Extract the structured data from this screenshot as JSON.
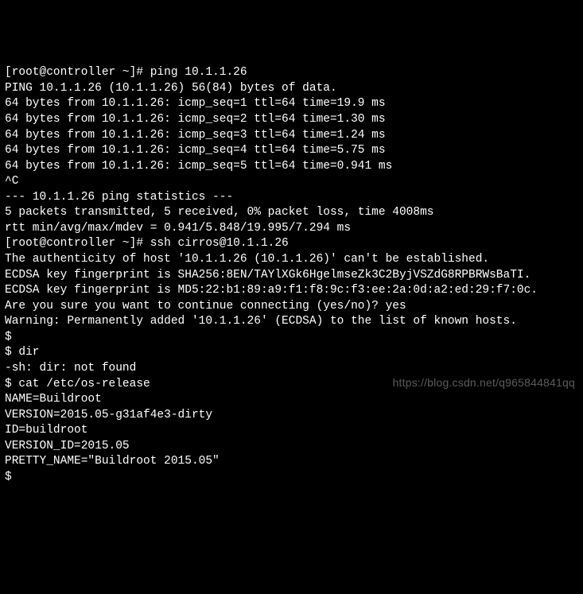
{
  "lines": [
    "[root@controller ~]# ping 10.1.1.26",
    "PING 10.1.1.26 (10.1.1.26) 56(84) bytes of data.",
    "64 bytes from 10.1.1.26: icmp_seq=1 ttl=64 time=19.9 ms",
    "64 bytes from 10.1.1.26: icmp_seq=2 ttl=64 time=1.30 ms",
    "64 bytes from 10.1.1.26: icmp_seq=3 ttl=64 time=1.24 ms",
    "64 bytes from 10.1.1.26: icmp_seq=4 ttl=64 time=5.75 ms",
    "64 bytes from 10.1.1.26: icmp_seq=5 ttl=64 time=0.941 ms",
    "^C",
    "--- 10.1.1.26 ping statistics ---",
    "5 packets transmitted, 5 received, 0% packet loss, time 4008ms",
    "rtt min/avg/max/mdev = 0.941/5.848/19.995/7.294 ms",
    "[root@controller ~]# ssh cirros@10.1.1.26",
    "The authenticity of host '10.1.1.26 (10.1.1.26)' can't be established.",
    "ECDSA key fingerprint is SHA256:8EN/TAYlXGk6HgelmseZk3C2ByjVSZdG8RPBRWsBaTI.",
    "ECDSA key fingerprint is MD5:22:b1:89:a9:f1:f8:9c:f3:ee:2a:0d:a2:ed:29:f7:0c.",
    "Are you sure you want to continue connecting (yes/no)? yes",
    "Warning: Permanently added '10.1.1.26' (ECDSA) to the list of known hosts.",
    "$ ",
    "$ dir",
    "-sh: dir: not found",
    "$ cat /etc/os-release",
    "NAME=Buildroot",
    "VERSION=2015.05-g31af4e3-dirty",
    "ID=buildroot",
    "VERSION_ID=2015.05",
    "PRETTY_NAME=\"Buildroot 2015.05\"",
    "$ "
  ],
  "watermark": "https://blog.csdn.net/q965844841qq"
}
